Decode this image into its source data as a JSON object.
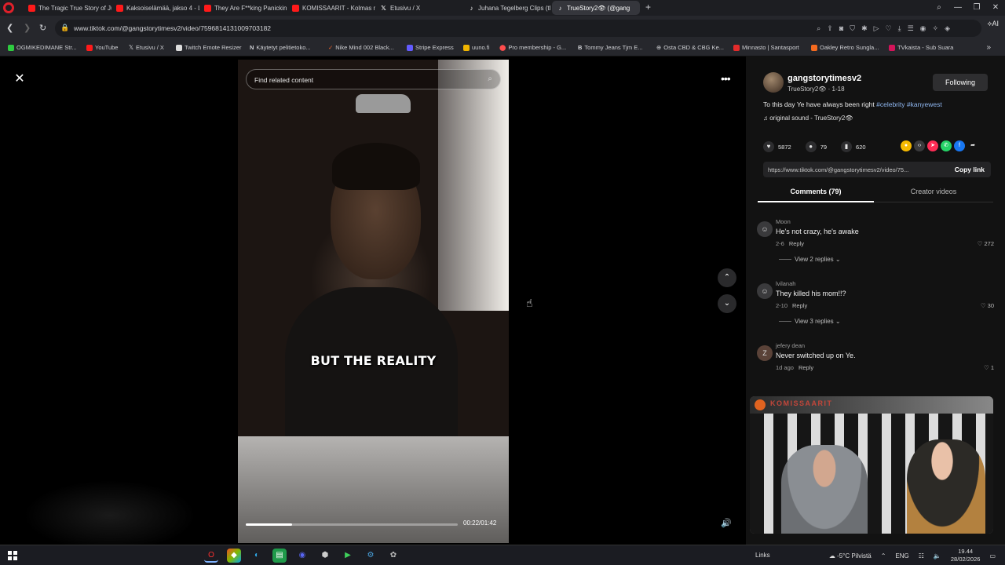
{
  "browser": {
    "tabs": [
      {
        "label": "The Tragic True Story of Ju",
        "icon": "youtube-icon"
      },
      {
        "label": "Kaksoiselämää, jakso 4 - Ll",
        "icon": "youtube-icon"
      },
      {
        "label": "They Are F**king Panickin",
        "icon": "youtube-icon"
      },
      {
        "label": "KOMISSAARIT - Kolmas m",
        "icon": "youtube-icon"
      },
      {
        "label": "Etusivu / X",
        "icon": "x-icon"
      },
      {
        "label": "Juhana Tegelberg Clips (tl",
        "icon": "tiktok-icon"
      },
      {
        "label": "TrueStory2👁 (@gang",
        "icon": "tiktok-icon"
      }
    ],
    "url": "www.tiktok.com/@gangstorytimesv2/video/7596814131009703182",
    "bookmarks": [
      "OGMIKEDIMANE Str...",
      "YouTube",
      "Etusivu / X",
      "Twitch Emote Resizer",
      "Käytetyt pelitietoko...",
      "Nike Mind 002 Black...",
      "Stripe Express",
      "uuno.fi",
      "Pro membership - G...",
      "Tommy Jeans Tjm E...",
      "Osta CBD & CBG Ke...",
      "Minnasto | Santasport",
      "Oakley Retro Sungla...",
      "TVkaista - Sub Suara"
    ],
    "ai_label": "AI"
  },
  "video": {
    "search_placeholder": "Find related content",
    "caption": "BUT THE REALITY",
    "time": "00:22/01:42",
    "progress_fraction": 0.22
  },
  "post": {
    "author": "gangstorytimesv2",
    "author_meta": "TrueStory2👁 · 1-18",
    "follow_label": "Following",
    "description_text": "To this day Ye have always been right ",
    "hashtags": "#celebrity #kanyewest",
    "music": "♫  original sound - TrueStory2👁",
    "likes": "5872",
    "comments": "79",
    "saves": "620",
    "link": "https://www.tiktok.com/@gangstorytimesv2/video/75...",
    "copy_label": "Copy link",
    "tab_comments": "Comments (79)",
    "tab_creator": "Creator videos"
  },
  "comments": [
    {
      "user": "Moon",
      "text": "He's not crazy, he's awake",
      "meta": "2-6",
      "reply": "Reply",
      "likes": "272",
      "replies": "View 2 replies ⌄"
    },
    {
      "user": "lvilanah",
      "text": "They killed his mom!!?",
      "meta": "2-10",
      "reply": "Reply",
      "likes": "30",
      "replies": "View 3 replies ⌄"
    },
    {
      "user": "jefery dean",
      "text": "Never switched up on Ye.",
      "meta": "1d ago",
      "reply": "Reply",
      "likes": "1",
      "avatar_letter": "Z"
    }
  ],
  "overlay": {
    "title": "KOMISSAARIT"
  },
  "taskbar": {
    "links": "Links",
    "weather": "-5°C  Pilvistä",
    "lang": "ENG",
    "time": "19.44",
    "date": "28/02/2026"
  }
}
